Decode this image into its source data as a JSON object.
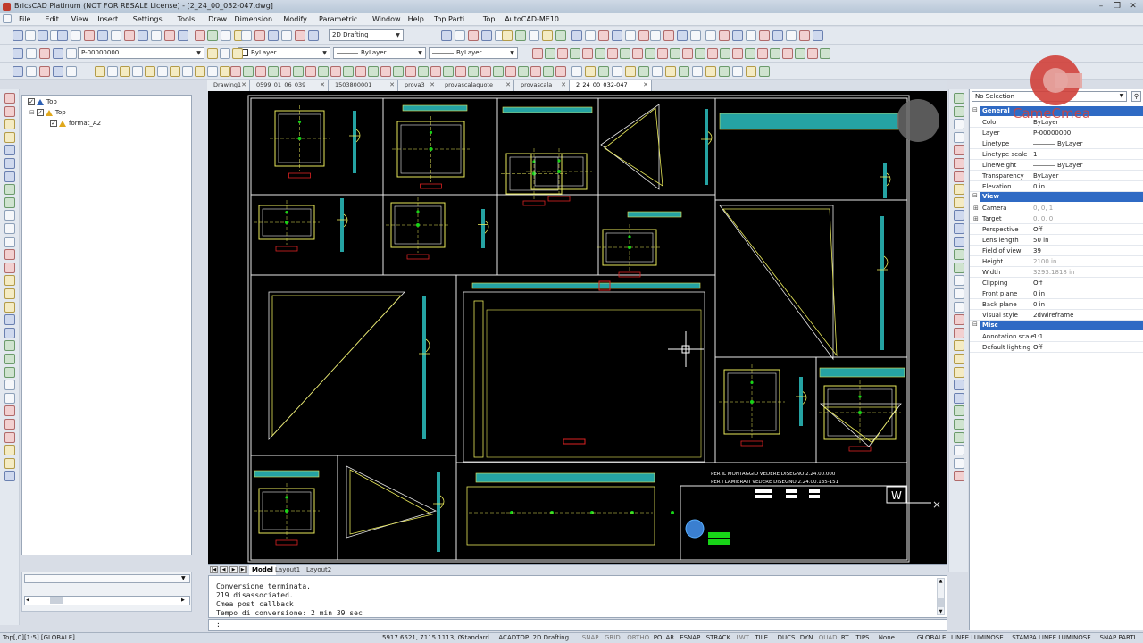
{
  "titlebar": {
    "title": "BricsCAD Platinum (NOT FOR RESALE License) - [2_24_00_032-047.dwg]",
    "minimize": "–",
    "restore": "❐",
    "close": "✕"
  },
  "menu": [
    "File",
    "Edit",
    "View",
    "Insert",
    "Settings",
    "Tools",
    "Draw",
    "Dimension",
    "Modify",
    "Parametric",
    "Window",
    "Help",
    "Top Parti",
    "Top",
    "AutoCAD-ME10"
  ],
  "toolbar": {
    "workspace": "2D Drafting",
    "layer": "P-00000000",
    "color": "ByLayer",
    "linetype": "ByLayer",
    "lineweight": "ByLayer"
  },
  "explorer": {
    "items": [
      {
        "label": "Top",
        "level": 0
      },
      {
        "label": "Top",
        "level": 1
      },
      {
        "label": "format_A2",
        "level": 2
      }
    ]
  },
  "tabs": [
    {
      "label": "Drawing1",
      "active": false
    },
    {
      "label": "0599_01_06_039",
      "active": false
    },
    {
      "label": "1503800001",
      "active": false
    },
    {
      "label": "prova3",
      "active": false
    },
    {
      "label": "provascalaquote",
      "active": false
    },
    {
      "label": "provascala",
      "active": false
    },
    {
      "label": "2_24_00_032-047",
      "active": true
    }
  ],
  "layouts": [
    {
      "label": "Model",
      "active": true
    },
    {
      "label": "Layout1",
      "active": false
    },
    {
      "label": "Layout2",
      "active": false
    }
  ],
  "drawing": {
    "note1": "PER IL MONTAGGIO VEDERE DISEGNO 2.24.00.000",
    "note2": "PER I LAMIERATI VEDERE DISEGNO 2.24.00.135-151",
    "w_marker": "W"
  },
  "command": {
    "history": [
      "Conversione terminata.",
      "219 disassociated.",
      "Cmea post callback",
      "Tempo di conversione: 2 min 39 sec"
    ],
    "prompt": ":"
  },
  "properties": {
    "selection": "No Selection",
    "sections": [
      {
        "name": "General",
        "rows": [
          {
            "k": "Color",
            "v": "ByLayer",
            "dim": false,
            "line": false
          },
          {
            "k": "Layer",
            "v": "P-00000000",
            "dim": false,
            "line": false
          },
          {
            "k": "Linetype",
            "v": "ByLayer",
            "dim": false,
            "line": true
          },
          {
            "k": "Linetype scale",
            "v": "1",
            "dim": false,
            "line": false
          },
          {
            "k": "Lineweight",
            "v": "ByLayer",
            "dim": false,
            "line": true
          },
          {
            "k": "Transparency",
            "v": "ByLayer",
            "dim": false,
            "line": false
          },
          {
            "k": "Elevation",
            "v": "0 in",
            "dim": false,
            "line": false
          }
        ]
      },
      {
        "name": "View",
        "rows": [
          {
            "k": "Camera",
            "v": "0, 0, 1",
            "dim": true,
            "line": false,
            "expand": true
          },
          {
            "k": "Target",
            "v": "0, 0, 0",
            "dim": true,
            "line": false,
            "expand": true
          },
          {
            "k": "Perspective",
            "v": "Off",
            "dim": false,
            "line": false
          },
          {
            "k": "Lens length",
            "v": "50 in",
            "dim": false,
            "line": false
          },
          {
            "k": "Field of view",
            "v": "39",
            "dim": false,
            "line": false
          },
          {
            "k": "Height",
            "v": "2100 in",
            "dim": true,
            "line": false
          },
          {
            "k": "Width",
            "v": "3293.1818 in",
            "dim": true,
            "line": false
          },
          {
            "k": "Clipping",
            "v": "Off",
            "dim": false,
            "line": false
          },
          {
            "k": "Front plane",
            "v": "0 in",
            "dim": false,
            "line": false
          },
          {
            "k": "Back plane",
            "v": "0 in",
            "dim": false,
            "line": false
          },
          {
            "k": "Visual style",
            "v": "2dWireframe",
            "dim": false,
            "line": false
          }
        ]
      },
      {
        "name": "Misc",
        "rows": [
          {
            "k": "Annotation scale",
            "v": "1:1",
            "dim": false,
            "line": false
          },
          {
            "k": "Default lighting",
            "v": "Off",
            "dim": false,
            "line": false
          }
        ]
      }
    ]
  },
  "logo": {
    "text": "CameCmea",
    "color": "#d0403a"
  },
  "status": {
    "left": "Top[,0][1:5] [GLOBALE]",
    "coords": "5917.6521, 7115.1113, 0",
    "items": [
      {
        "label": "Standard",
        "on": true
      },
      {
        "label": "ACADTOP",
        "on": true
      },
      {
        "label": "2D Drafting",
        "on": true
      },
      {
        "label": "SNAP",
        "on": false
      },
      {
        "label": "GRID",
        "on": false
      },
      {
        "label": "ORTHO",
        "on": false
      },
      {
        "label": "POLAR",
        "on": true
      },
      {
        "label": "ESNAP",
        "on": true
      },
      {
        "label": "STRACK",
        "on": true
      },
      {
        "label": "LWT",
        "on": false
      },
      {
        "label": "TILE",
        "on": true
      },
      {
        "label": "DUCS",
        "on": true
      },
      {
        "label": "DYN",
        "on": true
      },
      {
        "label": "QUAD",
        "on": false
      },
      {
        "label": "RT",
        "on": true
      },
      {
        "label": "TIPS",
        "on": true
      },
      {
        "label": "None",
        "on": true
      },
      {
        "label": "GLOBALE",
        "on": true
      },
      {
        "label": "LINEE LUMINOSE",
        "on": true
      },
      {
        "label": "STAMPA LINEE LUMINOSE",
        "on": true
      },
      {
        "label": "SNAP PARTI",
        "on": true
      }
    ]
  }
}
